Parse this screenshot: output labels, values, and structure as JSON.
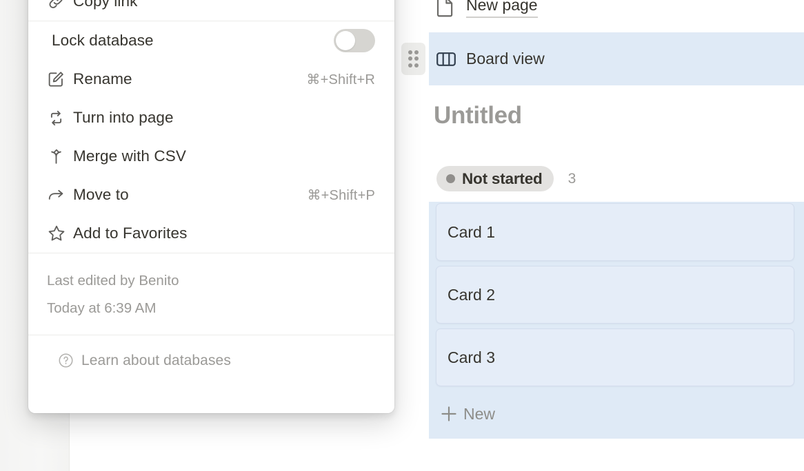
{
  "menu": {
    "top_items": [
      {
        "icon": "link-icon",
        "label": "Copy link",
        "shortcut": ""
      }
    ],
    "lock": {
      "label": "Lock database",
      "toggle_state": "off"
    },
    "items": [
      {
        "icon": "pencil-square-icon",
        "label": "Rename",
        "shortcut": "⌘+Shift+R"
      },
      {
        "icon": "turn-into-page-icon",
        "label": "Turn into page",
        "shortcut": ""
      },
      {
        "icon": "merge-icon",
        "label": "Merge with CSV",
        "shortcut": ""
      },
      {
        "icon": "arrow-right-icon",
        "label": "Move to",
        "shortcut": "⌘+Shift+P"
      },
      {
        "icon": "star-icon",
        "label": "Add to Favorites",
        "shortcut": ""
      }
    ],
    "meta": {
      "edited_by": "Last edited by Benito",
      "edited_at": "Today at 6:39 AM"
    },
    "footer": {
      "icon": "question-circle-icon",
      "label": "Learn about databases"
    }
  },
  "nav": {
    "new_page": {
      "icon": "page-icon",
      "label": "New page"
    },
    "board_view": {
      "icon": "board-icon",
      "label": "Board view",
      "selected": true
    },
    "drag_handle": "drag-handle-icon"
  },
  "board": {
    "title": "Untitled",
    "group": {
      "status_label": "Not started",
      "count": "3"
    },
    "cards": [
      {
        "title": "Card 1"
      },
      {
        "title": "Card 2"
      },
      {
        "title": "Card 3"
      }
    ],
    "new_card_label": "New",
    "new_card_icon": "plus-icon"
  },
  "colors": {
    "selection_blue": "#dfeaf6",
    "card_blue": "#e5edf8",
    "card_border": "#d3dded",
    "text_primary": "#37352f",
    "text_muted": "#9b9a97",
    "chip_grey": "#e3e2e0",
    "toggle_off": "#d6d5d1"
  }
}
